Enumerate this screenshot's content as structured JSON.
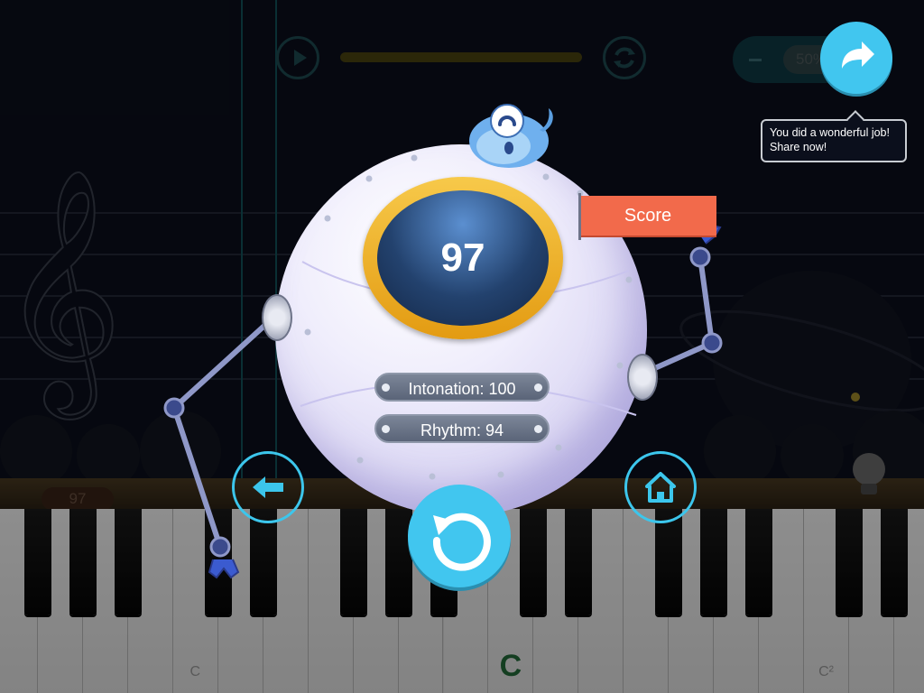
{
  "header": {
    "speed_value": "50%"
  },
  "share": {
    "tooltip": "You did a wonderful job!\nShare now!"
  },
  "result": {
    "score": "97",
    "intonation": "Intonation: 100",
    "rhythm": "Rhythm: 94",
    "badge": "Score"
  },
  "keyboard": {
    "previous_score": "97",
    "labels": {
      "c_low": "C",
      "c_mid": "C",
      "c_high": "C²"
    }
  },
  "icons": {
    "play": "play-icon",
    "loop": "loop-icon",
    "share": "share-arrow-icon",
    "back": "back-arrow-icon",
    "home": "home-icon",
    "replay": "replay-icon",
    "treble_clef": "treble-clef-icon",
    "lightbulb": "lightbulb-icon"
  },
  "colors": {
    "accent_cyan": "#41c6ef",
    "score_flag": "#f26a4b",
    "gold_ring": "#f2b431",
    "background": "#0b0f1c"
  }
}
